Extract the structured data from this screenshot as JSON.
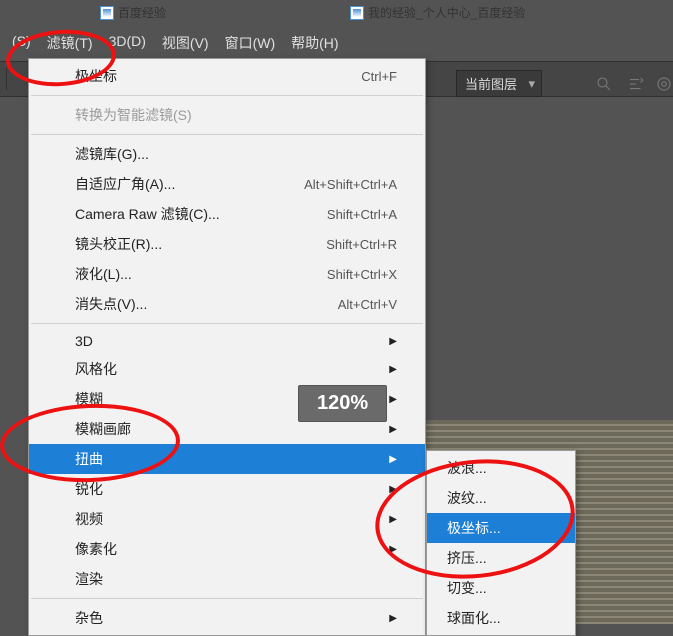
{
  "tabs": {
    "left_label": "百度经验",
    "right_label": "我的经验_个人中心_百度经验"
  },
  "menubar": {
    "items": [
      "(S)",
      "滤镜(T)",
      "3D(D)",
      "视图(V)",
      "窗口(W)",
      "帮助(H)"
    ],
    "active_index": 1
  },
  "toolbar": {
    "layer_select": "当前图层"
  },
  "zoom_badge": "120%",
  "filter_menu": {
    "last_filter": {
      "label": "极坐标",
      "shortcut": "Ctrl+F"
    },
    "convert_smart": {
      "label": "转换为智能滤镜(S)"
    },
    "items": [
      {
        "label": "滤镜库(G)...",
        "shortcut": ""
      },
      {
        "label": "自适应广角(A)...",
        "shortcut": "Alt+Shift+Ctrl+A"
      },
      {
        "label": "Camera Raw 滤镜(C)...",
        "shortcut": "Shift+Ctrl+A"
      },
      {
        "label": "镜头校正(R)...",
        "shortcut": "Shift+Ctrl+R"
      },
      {
        "label": "液化(L)...",
        "shortcut": "Shift+Ctrl+X"
      },
      {
        "label": "消失点(V)...",
        "shortcut": "Alt+Ctrl+V"
      }
    ],
    "submenus": [
      {
        "label": "3D"
      },
      {
        "label": "风格化"
      },
      {
        "label": "模糊"
      },
      {
        "label": "模糊画廊"
      },
      {
        "label": "扭曲",
        "highlight": true
      },
      {
        "label": "锐化"
      },
      {
        "label": "视频"
      },
      {
        "label": "像素化"
      },
      {
        "label": "渲染"
      },
      {
        "label": "杂色"
      }
    ]
  },
  "distort_submenu": {
    "items": [
      {
        "label": "波浪..."
      },
      {
        "label": "波纹..."
      },
      {
        "label": "极坐标...",
        "highlight": true
      },
      {
        "label": "挤压..."
      },
      {
        "label": "切变..."
      },
      {
        "label": "球面化..."
      }
    ]
  }
}
